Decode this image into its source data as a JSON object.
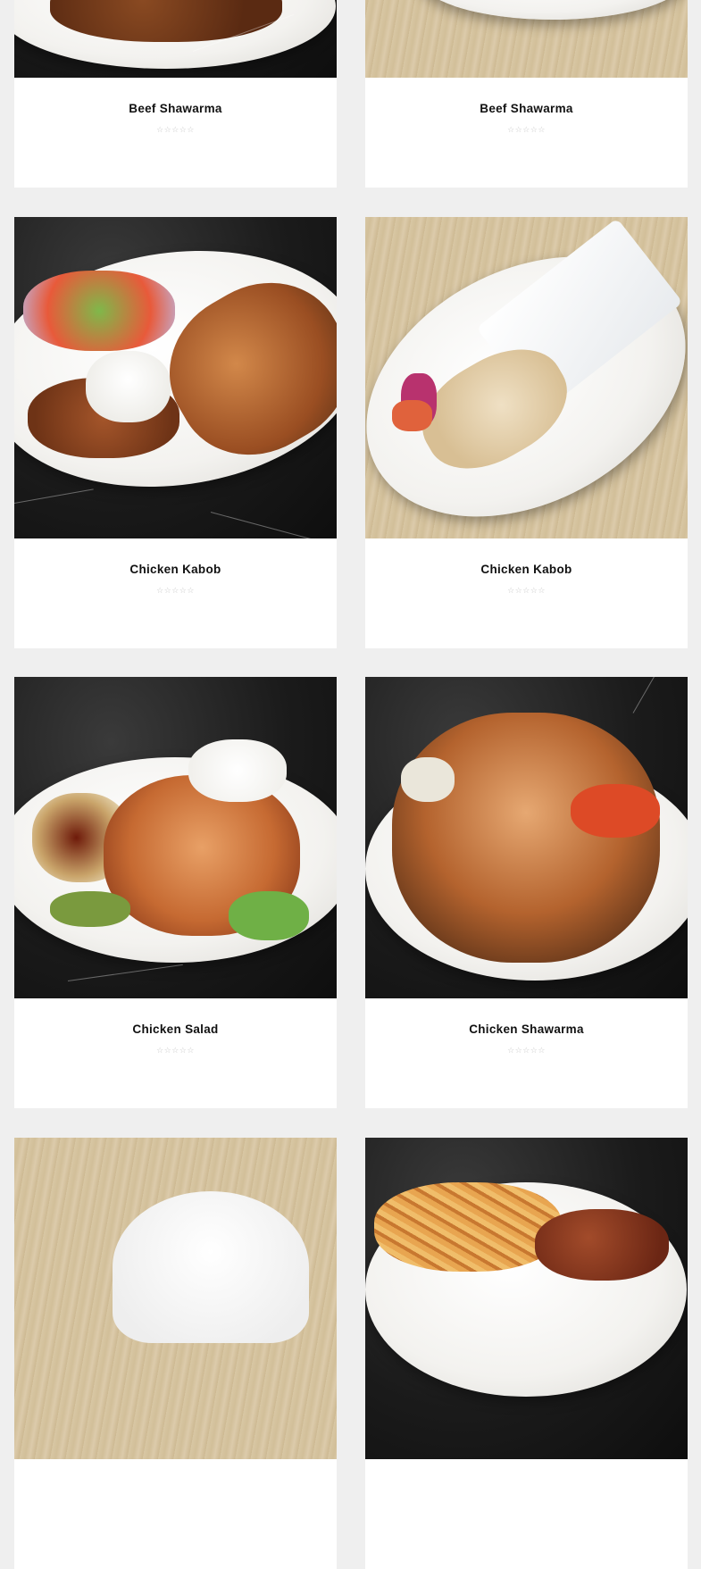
{
  "products": [
    {
      "name": "Beef Shawarma",
      "rating": "☆☆☆☆☆"
    },
    {
      "name": "Beef Shawarma",
      "rating": "☆☆☆☆☆"
    },
    {
      "name": "Chicken Kabob",
      "rating": "☆☆☆☆☆"
    },
    {
      "name": "Chicken Kabob",
      "rating": "☆☆☆☆☆"
    },
    {
      "name": "Chicken Salad",
      "rating": "☆☆☆☆☆"
    },
    {
      "name": "Chicken Shawarma",
      "rating": "☆☆☆☆☆"
    },
    {
      "name": "",
      "rating": ""
    },
    {
      "name": "",
      "rating": ""
    }
  ]
}
